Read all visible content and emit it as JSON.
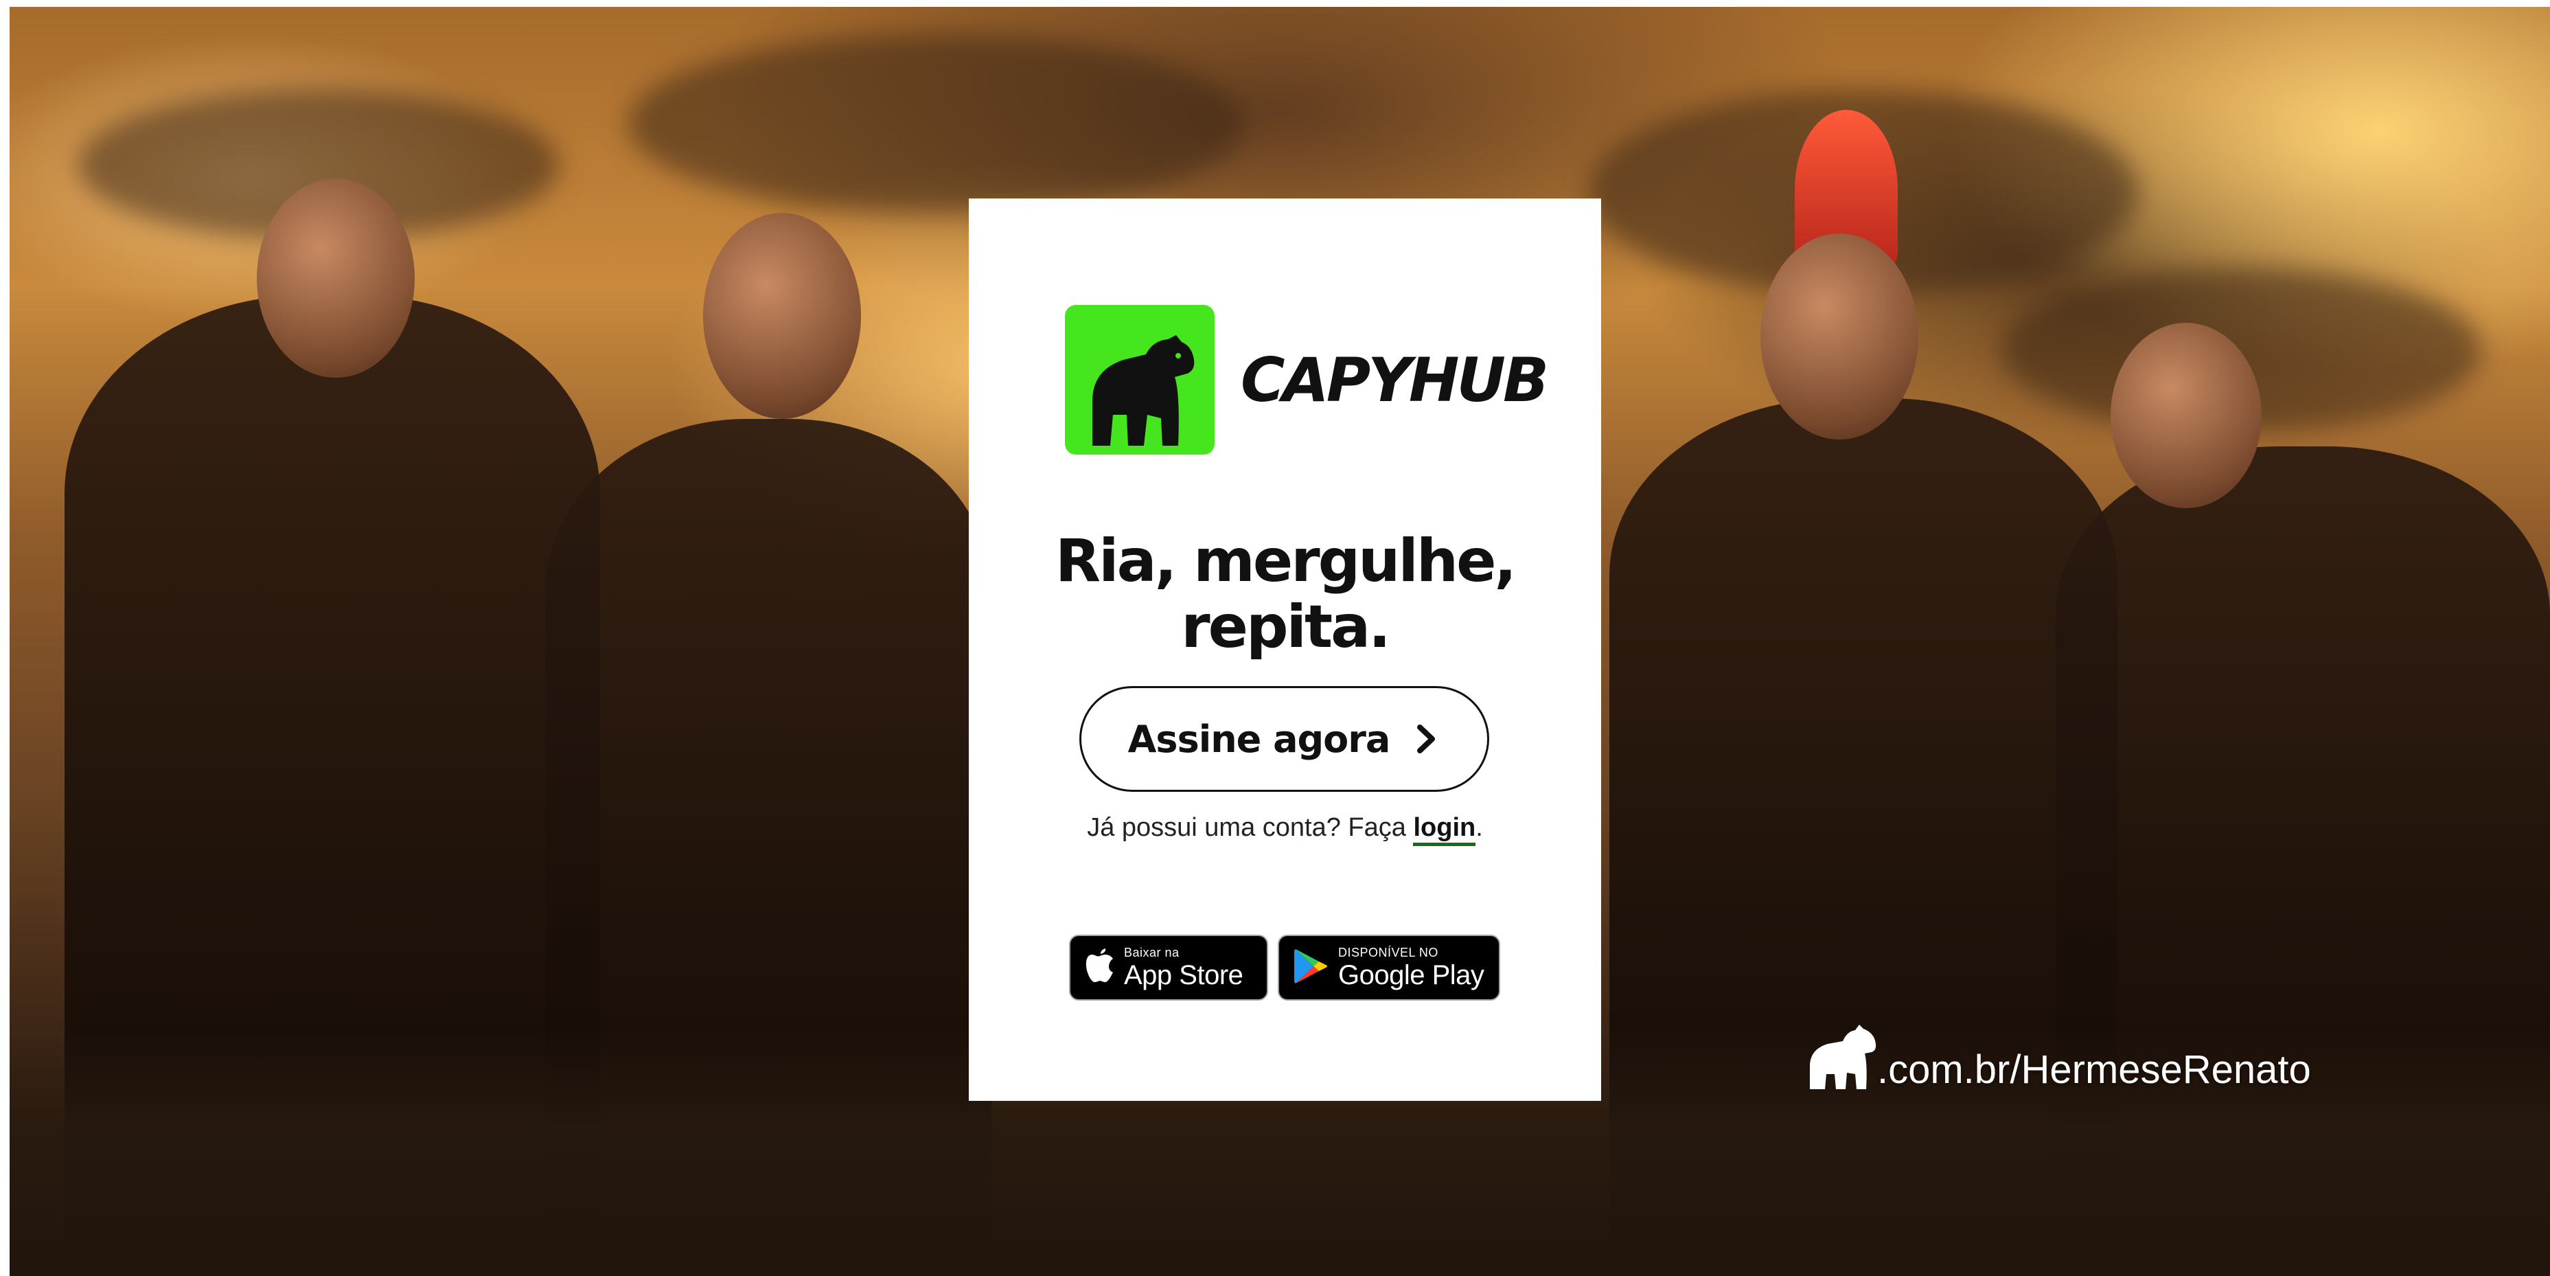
{
  "brand": {
    "name": "CapyHub",
    "logo_text": "CAPYHUB",
    "accent_color": "#46e61e"
  },
  "hero": {
    "headline_line1": "Ria, mergulhe,",
    "headline_line2": "repita."
  },
  "cta": {
    "label": "Assine agora",
    "icon": "chevron-right-icon"
  },
  "login": {
    "prefix": "Já possui uma conta? Faça ",
    "link_label": "login",
    "suffix": "."
  },
  "stores": {
    "apple": {
      "small": "Baixar na",
      "big": "App Store",
      "icon": "apple-icon"
    },
    "google": {
      "small": "DISPONÍVEL NO",
      "big": "Google Play",
      "icon": "google-play-icon"
    }
  },
  "overlay": {
    "url": ".com.br/HermeseRenato",
    "icon": "capybara-icon"
  }
}
